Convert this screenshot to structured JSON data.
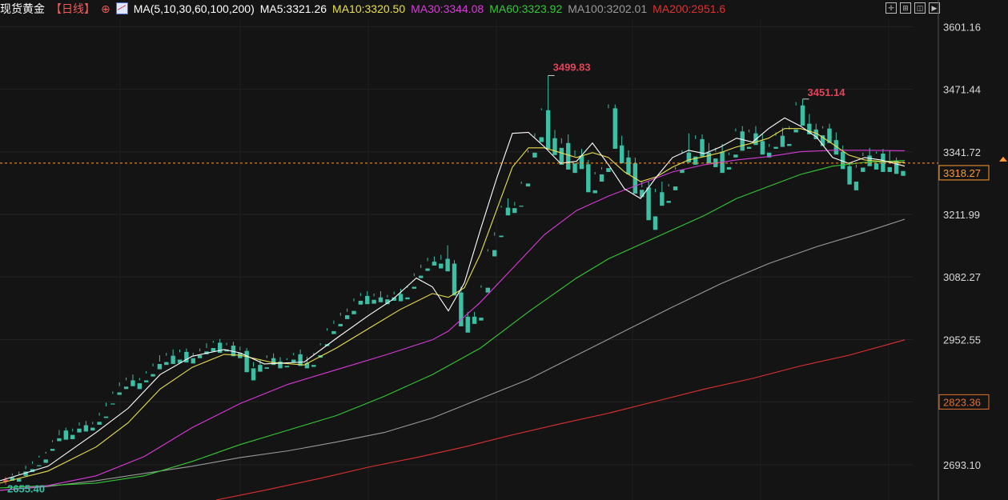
{
  "header": {
    "title": "现货黄金",
    "period": "【日线】",
    "circle_icon": "⊕",
    "ma_params": "MA(5,10,30,60,100,200)",
    "ma5": "MA5:3321.26",
    "ma10": "MA10:3320.50",
    "ma30": "MA30:3344.08",
    "ma60": "MA60:3323.92",
    "ma100": "MA100:3202.01",
    "ma200": "MA200:2951.6",
    "tool_icons": [
      "crosshair-icon",
      "grid-icon",
      "layout-icon",
      "next-icon"
    ]
  },
  "colors": {
    "background": "#141414",
    "up": "#e0455a",
    "down": "#3cbfa4",
    "ma5": "#ffffff",
    "ma10": "#e8e050",
    "ma30": "#d83ad8",
    "ma60": "#34c834",
    "ma100": "#9a9a9a",
    "ma200": "#e03030",
    "current_line": "#ff9a30"
  },
  "chart_data": {
    "type": "candlestick",
    "y_ticks": [
      "3601.16",
      "3471.44",
      "3341.72",
      "3211.99",
      "3082.27",
      "2952.55",
      "2823.36",
      "2693.10"
    ],
    "ylim": [
      2620,
      3615
    ],
    "current_price": "3318.27",
    "current_price_value": 3318.27,
    "marker_price": "2823.36",
    "marker_price_value": 2823.36,
    "high_annotation": "3499.83",
    "high_annotation_value": 3499.83,
    "second_high_annotation": "3451.14",
    "second_high_annotation_value": 3451.14,
    "low_annotation": "2655.40",
    "low_annotation_value": 2655.4,
    "candles": [
      [
        2658,
        2668,
        2662,
        2652
      ],
      [
        2667,
        2675,
        2660,
        2671
      ],
      [
        2664,
        2679,
        2658,
        2673
      ],
      [
        2679,
        2691,
        2670,
        2684
      ],
      [
        2684,
        2700,
        2678,
        2695
      ],
      [
        2692,
        2712,
        2690,
        2708
      ],
      [
        2704,
        2720,
        2697,
        2716
      ],
      [
        2726,
        2744,
        2722,
        2740
      ],
      [
        2748,
        2765,
        2742,
        2754
      ],
      [
        2764,
        2770,
        2745,
        2755
      ],
      [
        2755,
        2768,
        2746,
        2762
      ],
      [
        2768,
        2781,
        2760,
        2774
      ],
      [
        2775,
        2784,
        2762,
        2768
      ],
      [
        2770,
        2782,
        2764,
        2777
      ],
      [
        2782,
        2801,
        2776,
        2795
      ],
      [
        2793,
        2822,
        2790,
        2814
      ],
      [
        2820,
        2845,
        2818,
        2840
      ],
      [
        2843,
        2864,
        2838,
        2856
      ],
      [
        2855,
        2874,
        2850,
        2868
      ],
      [
        2868,
        2880,
        2856,
        2863
      ],
      [
        2862,
        2873,
        2850,
        2868
      ],
      [
        2868,
        2887,
        2864,
        2882
      ],
      [
        2881,
        2903,
        2876,
        2897
      ],
      [
        2902,
        2920,
        2891,
        2907
      ],
      [
        2906,
        2925,
        2900,
        2919
      ],
      [
        2919,
        2932,
        2902,
        2911
      ],
      [
        2911,
        2932,
        2904,
        2926
      ],
      [
        2927,
        2934,
        2905,
        2913
      ],
      [
        2914,
        2925,
        2903,
        2919
      ],
      [
        2920,
        2934,
        2914,
        2928
      ],
      [
        2928,
        2945,
        2922,
        2935
      ],
      [
        2935,
        2950,
        2928,
        2946
      ],
      [
        2946,
        2954,
        2925,
        2933
      ],
      [
        2932,
        2946,
        2928,
        2941
      ],
      [
        2940,
        2948,
        2918,
        2924
      ],
      [
        2925,
        2938,
        2914,
        2930
      ],
      [
        2929,
        2935,
        2885,
        2892
      ],
      [
        2893,
        2906,
        2868,
        2896
      ],
      [
        2900,
        2912,
        2886,
        2894
      ],
      [
        2895,
        2920,
        2892,
        2914
      ],
      [
        2914,
        2924,
        2900,
        2908
      ],
      [
        2907,
        2916,
        2893,
        2899
      ],
      [
        2898,
        2914,
        2895,
        2910
      ],
      [
        2911,
        2925,
        2905,
        2920
      ],
      [
        2922,
        2932,
        2898,
        2905
      ],
      [
        2904,
        2917,
        2893,
        2900
      ],
      [
        2900,
        2925,
        2896,
        2920
      ],
      [
        2920,
        2945,
        2915,
        2941
      ],
      [
        2943,
        2976,
        2939,
        2971
      ],
      [
        2970,
        2992,
        2964,
        2985
      ],
      [
        2985,
        3008,
        2980,
        3002
      ],
      [
        3003,
        3017,
        2995,
        3010
      ],
      [
        3012,
        3038,
        3005,
        3032
      ],
      [
        3033,
        3049,
        3025,
        3043
      ],
      [
        3043,
        3053,
        3026,
        3035
      ],
      [
        3035,
        3048,
        3027,
        3042
      ],
      [
        3040,
        3053,
        3030,
        3036
      ],
      [
        3036,
        3045,
        3026,
        3040
      ],
      [
        3040,
        3052,
        3033,
        3046
      ],
      [
        3047,
        3058,
        3032,
        3038
      ],
      [
        3040,
        3065,
        3036,
        3060
      ],
      [
        3062,
        3090,
        3058,
        3084
      ],
      [
        3085,
        3108,
        3080,
        3101
      ],
      [
        3100,
        3122,
        3095,
        3115
      ],
      [
        3114,
        3125,
        3106,
        3110
      ],
      [
        3110,
        3128,
        3100,
        3118
      ],
      [
        3120,
        3148,
        3094,
        3112
      ],
      [
        3110,
        3117,
        3044,
        3052
      ],
      [
        3050,
        3062,
        2980,
        3000
      ],
      [
        3000,
        3010,
        2967,
        2996
      ],
      [
        3000,
        3010,
        2985,
        2994
      ],
      [
        2998,
        3065,
        2992,
        3060
      ],
      [
        3060,
        3140,
        3050,
        3135
      ],
      [
        3138,
        3175,
        3125,
        3168
      ],
      [
        3168,
        3230,
        3165,
        3226
      ],
      [
        3226,
        3245,
        3210,
        3225
      ],
      [
        3225,
        3238,
        3215,
        3230
      ],
      [
        3230,
        3280,
        3228,
        3275
      ],
      [
        3276,
        3345,
        3270,
        3340
      ],
      [
        3340,
        3380,
        3330,
        3372
      ],
      [
        3372,
        3432,
        3362,
        3428
      ],
      [
        3428,
        3500,
        3348,
        3368
      ],
      [
        3370,
        3387,
        3335,
        3349
      ],
      [
        3350,
        3370,
        3315,
        3359
      ],
      [
        3360,
        3378,
        3305,
        3318
      ],
      [
        3318,
        3345,
        3298,
        3333
      ],
      [
        3334,
        3348,
        3306,
        3316
      ],
      [
        3316,
        3325,
        3258,
        3262
      ],
      [
        3262,
        3300,
        3256,
        3295
      ],
      [
        3295,
        3310,
        3280,
        3305
      ],
      [
        3308,
        3440,
        3300,
        3432
      ],
      [
        3432,
        3440,
        3348,
        3356
      ],
      [
        3355,
        3375,
        3318,
        3330
      ],
      [
        3330,
        3345,
        3295,
        3318
      ],
      [
        3318,
        3330,
        3255,
        3263
      ],
      [
        3263,
        3280,
        3248,
        3268
      ],
      [
        3268,
        3280,
        3200,
        3208
      ],
      [
        3208,
        3265,
        3180,
        3258
      ],
      [
        3258,
        3280,
        3230,
        3239
      ],
      [
        3240,
        3275,
        3236,
        3270
      ],
      [
        3270,
        3310,
        3262,
        3305
      ],
      [
        3305,
        3345,
        3298,
        3339
      ],
      [
        3340,
        3380,
        3320,
        3331
      ],
      [
        3332,
        3376,
        3315,
        3368
      ],
      [
        3368,
        3378,
        3332,
        3340
      ],
      [
        3340,
        3360,
        3318,
        3328
      ],
      [
        3328,
        3350,
        3310,
        3342
      ],
      [
        3342,
        3358,
        3298,
        3310
      ],
      [
        3310,
        3340,
        3305,
        3335
      ],
      [
        3336,
        3390,
        3330,
        3384
      ],
      [
        3384,
        3395,
        3344,
        3352
      ],
      [
        3352,
        3388,
        3348,
        3382
      ],
      [
        3380,
        3395,
        3356,
        3362
      ],
      [
        3364,
        3378,
        3336,
        3340
      ],
      [
        3340,
        3358,
        3330,
        3352
      ],
      [
        3352,
        3382,
        3348,
        3375
      ],
      [
        3375,
        3392,
        3352,
        3358
      ],
      [
        3358,
        3395,
        3354,
        3388
      ],
      [
        3388,
        3445,
        3382,
        3438
      ],
      [
        3438,
        3451,
        3396,
        3402
      ],
      [
        3400,
        3420,
        3378,
        3386
      ],
      [
        3388,
        3400,
        3368,
        3376
      ],
      [
        3376,
        3395,
        3354,
        3390
      ],
      [
        3390,
        3400,
        3360,
        3366
      ],
      [
        3366,
        3382,
        3336,
        3342
      ],
      [
        3342,
        3355,
        3306,
        3312
      ],
      [
        3312,
        3320,
        3274,
        3280
      ],
      [
        3280,
        3315,
        3262,
        3309
      ],
      [
        3309,
        3340,
        3300,
        3333
      ],
      [
        3334,
        3350,
        3312,
        3318
      ],
      [
        3318,
        3342,
        3305,
        3338
      ],
      [
        3338,
        3348,
        3300,
        3310
      ],
      [
        3310,
        3345,
        3300,
        3324
      ],
      [
        3324,
        3330,
        3296,
        3300
      ],
      [
        3302,
        3322,
        3292,
        3318
      ]
    ],
    "ma_lines": {
      "ma5": [
        [
          0,
          2660
        ],
        [
          60,
          2690
        ],
        [
          120,
          2760
        ],
        [
          160,
          2810
        ],
        [
          200,
          2880
        ],
        [
          240,
          2918
        ],
        [
          280,
          2932
        ],
        [
          300,
          2925
        ],
        [
          330,
          2902
        ],
        [
          380,
          2906
        ],
        [
          420,
          2955
        ],
        [
          460,
          3002
        ],
        [
          490,
          3035
        ],
        [
          520,
          3080
        ],
        [
          540,
          3062
        ],
        [
          560,
          3012
        ],
        [
          580,
          3070
        ],
        [
          600,
          3180
        ],
        [
          620,
          3285
        ],
        [
          640,
          3380
        ],
        [
          660,
          3382
        ],
        [
          680,
          3352
        ],
        [
          700,
          3318
        ],
        [
          720,
          3322
        ],
        [
          740,
          3360
        ],
        [
          760,
          3315
        ],
        [
          780,
          3265
        ],
        [
          800,
          3245
        ],
        [
          820,
          3290
        ],
        [
          840,
          3330
        ],
        [
          860,
          3345
        ],
        [
          880,
          3338
        ],
        [
          900,
          3352
        ],
        [
          920,
          3370
        ],
        [
          940,
          3362
        ],
        [
          960,
          3390
        ],
        [
          980,
          3412
        ],
        [
          1000,
          3395
        ],
        [
          1020,
          3372
        ],
        [
          1040,
          3330
        ],
        [
          1060,
          3318
        ],
        [
          1080,
          3330
        ],
        [
          1100,
          3325
        ],
        [
          1130,
          3312
        ]
      ],
      "ma10": [
        [
          0,
          2655
        ],
        [
          60,
          2680
        ],
        [
          120,
          2730
        ],
        [
          160,
          2780
        ],
        [
          200,
          2850
        ],
        [
          240,
          2895
        ],
        [
          280,
          2922
        ],
        [
          300,
          2920
        ],
        [
          340,
          2905
        ],
        [
          380,
          2900
        ],
        [
          420,
          2935
        ],
        [
          460,
          2975
        ],
        [
          500,
          3015
        ],
        [
          540,
          3048
        ],
        [
          560,
          3040
        ],
        [
          580,
          3060
        ],
        [
          600,
          3130
        ],
        [
          620,
          3220
        ],
        [
          640,
          3310
        ],
        [
          660,
          3350
        ],
        [
          680,
          3350
        ],
        [
          700,
          3340
        ],
        [
          720,
          3330
        ],
        [
          740,
          3340
        ],
        [
          760,
          3330
        ],
        [
          780,
          3300
        ],
        [
          800,
          3280
        ],
        [
          820,
          3290
        ],
        [
          840,
          3310
        ],
        [
          860,
          3325
        ],
        [
          880,
          3332
        ],
        [
          900,
          3340
        ],
        [
          920,
          3352
        ],
        [
          940,
          3360
        ],
        [
          960,
          3370
        ],
        [
          980,
          3390
        ],
        [
          1000,
          3390
        ],
        [
          1020,
          3380
        ],
        [
          1040,
          3358
        ],
        [
          1060,
          3335
        ],
        [
          1080,
          3325
        ],
        [
          1100,
          3322
        ],
        [
          1130,
          3320
        ]
      ],
      "ma30": [
        [
          0,
          2640
        ],
        [
          60,
          2650
        ],
        [
          120,
          2670
        ],
        [
          180,
          2710
        ],
        [
          240,
          2770
        ],
        [
          300,
          2820
        ],
        [
          360,
          2860
        ],
        [
          420,
          2890
        ],
        [
          480,
          2920
        ],
        [
          540,
          2952
        ],
        [
          560,
          2970
        ],
        [
          600,
          3030
        ],
        [
          640,
          3100
        ],
        [
          680,
          3170
        ],
        [
          720,
          3220
        ],
        [
          760,
          3250
        ],
        [
          800,
          3275
        ],
        [
          840,
          3300
        ],
        [
          880,
          3315
        ],
        [
          920,
          3325
        ],
        [
          960,
          3332
        ],
        [
          1000,
          3342
        ],
        [
          1040,
          3345
        ],
        [
          1080,
          3345
        ],
        [
          1130,
          3344
        ]
      ],
      "ma60": [
        [
          0,
          2645
        ],
        [
          60,
          2650
        ],
        [
          120,
          2655
        ],
        [
          180,
          2670
        ],
        [
          240,
          2700
        ],
        [
          300,
          2735
        ],
        [
          360,
          2765
        ],
        [
          420,
          2795
        ],
        [
          480,
          2835
        ],
        [
          540,
          2880
        ],
        [
          600,
          2935
        ],
        [
          660,
          3010
        ],
        [
          720,
          3080
        ],
        [
          760,
          3120
        ],
        [
          800,
          3150
        ],
        [
          840,
          3180
        ],
        [
          880,
          3210
        ],
        [
          920,
          3245
        ],
        [
          960,
          3270
        ],
        [
          1000,
          3295
        ],
        [
          1040,
          3312
        ],
        [
          1080,
          3320
        ],
        [
          1130,
          3324
        ]
      ],
      "ma100": [
        [
          0,
          2640
        ],
        [
          60,
          2648
        ],
        [
          120,
          2660
        ],
        [
          180,
          2675
        ],
        [
          240,
          2690
        ],
        [
          300,
          2708
        ],
        [
          360,
          2722
        ],
        [
          420,
          2740
        ],
        [
          480,
          2760
        ],
        [
          540,
          2790
        ],
        [
          600,
          2830
        ],
        [
          660,
          2870
        ],
        [
          720,
          2920
        ],
        [
          780,
          2970
        ],
        [
          840,
          3020
        ],
        [
          900,
          3068
        ],
        [
          960,
          3110
        ],
        [
          1020,
          3145
        ],
        [
          1080,
          3175
        ],
        [
          1130,
          3202
        ]
      ],
      "ma200": [
        [
          270,
          2620
        ],
        [
          330,
          2640
        ],
        [
          400,
          2665
        ],
        [
          460,
          2688
        ],
        [
          520,
          2708
        ],
        [
          580,
          2730
        ],
        [
          640,
          2755
        ],
        [
          700,
          2778
        ],
        [
          760,
          2800
        ],
        [
          820,
          2825
        ],
        [
          880,
          2850
        ],
        [
          940,
          2872
        ],
        [
          1000,
          2898
        ],
        [
          1060,
          2920
        ],
        [
          1130,
          2952
        ]
      ]
    }
  }
}
